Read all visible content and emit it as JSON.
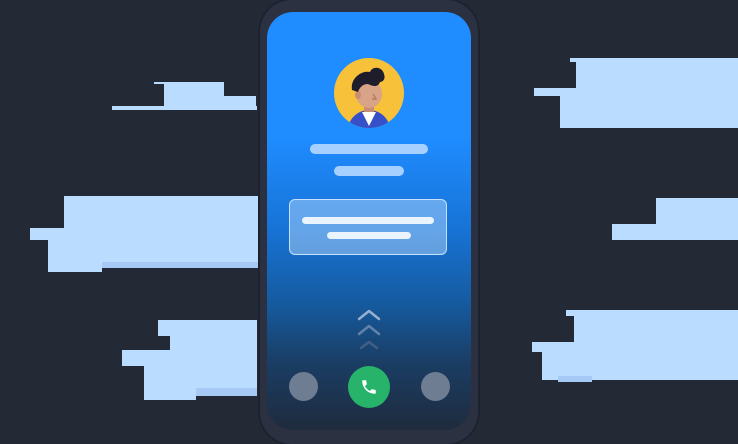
{
  "scene": {
    "background_color": "#242936",
    "cloud_color": "#b9dcff",
    "cloud_shade_color": "#a7c9f5"
  },
  "phone": {
    "body_color": "#2b3140",
    "screen_gradient_top": "#1f8cff",
    "screen_gradient_bottom": "#1f2b3d",
    "caller": {
      "avatar_icon": "person-avatar-icon",
      "avatar_bg_color": "#f7c23a",
      "name_placeholder": "",
      "subtitle_placeholder": ""
    },
    "message_card": {
      "line1": "",
      "line2": ""
    },
    "swipe_hint_icon": "chevron-up-icon",
    "buttons": [
      {
        "name": "left-option-button",
        "icon": "circle-icon",
        "color": "#6f7d93"
      },
      {
        "name": "answer-call-button",
        "icon": "phone-icon",
        "color": "#27b36a"
      },
      {
        "name": "right-option-button",
        "icon": "circle-icon",
        "color": "#6f7d93"
      }
    ]
  }
}
